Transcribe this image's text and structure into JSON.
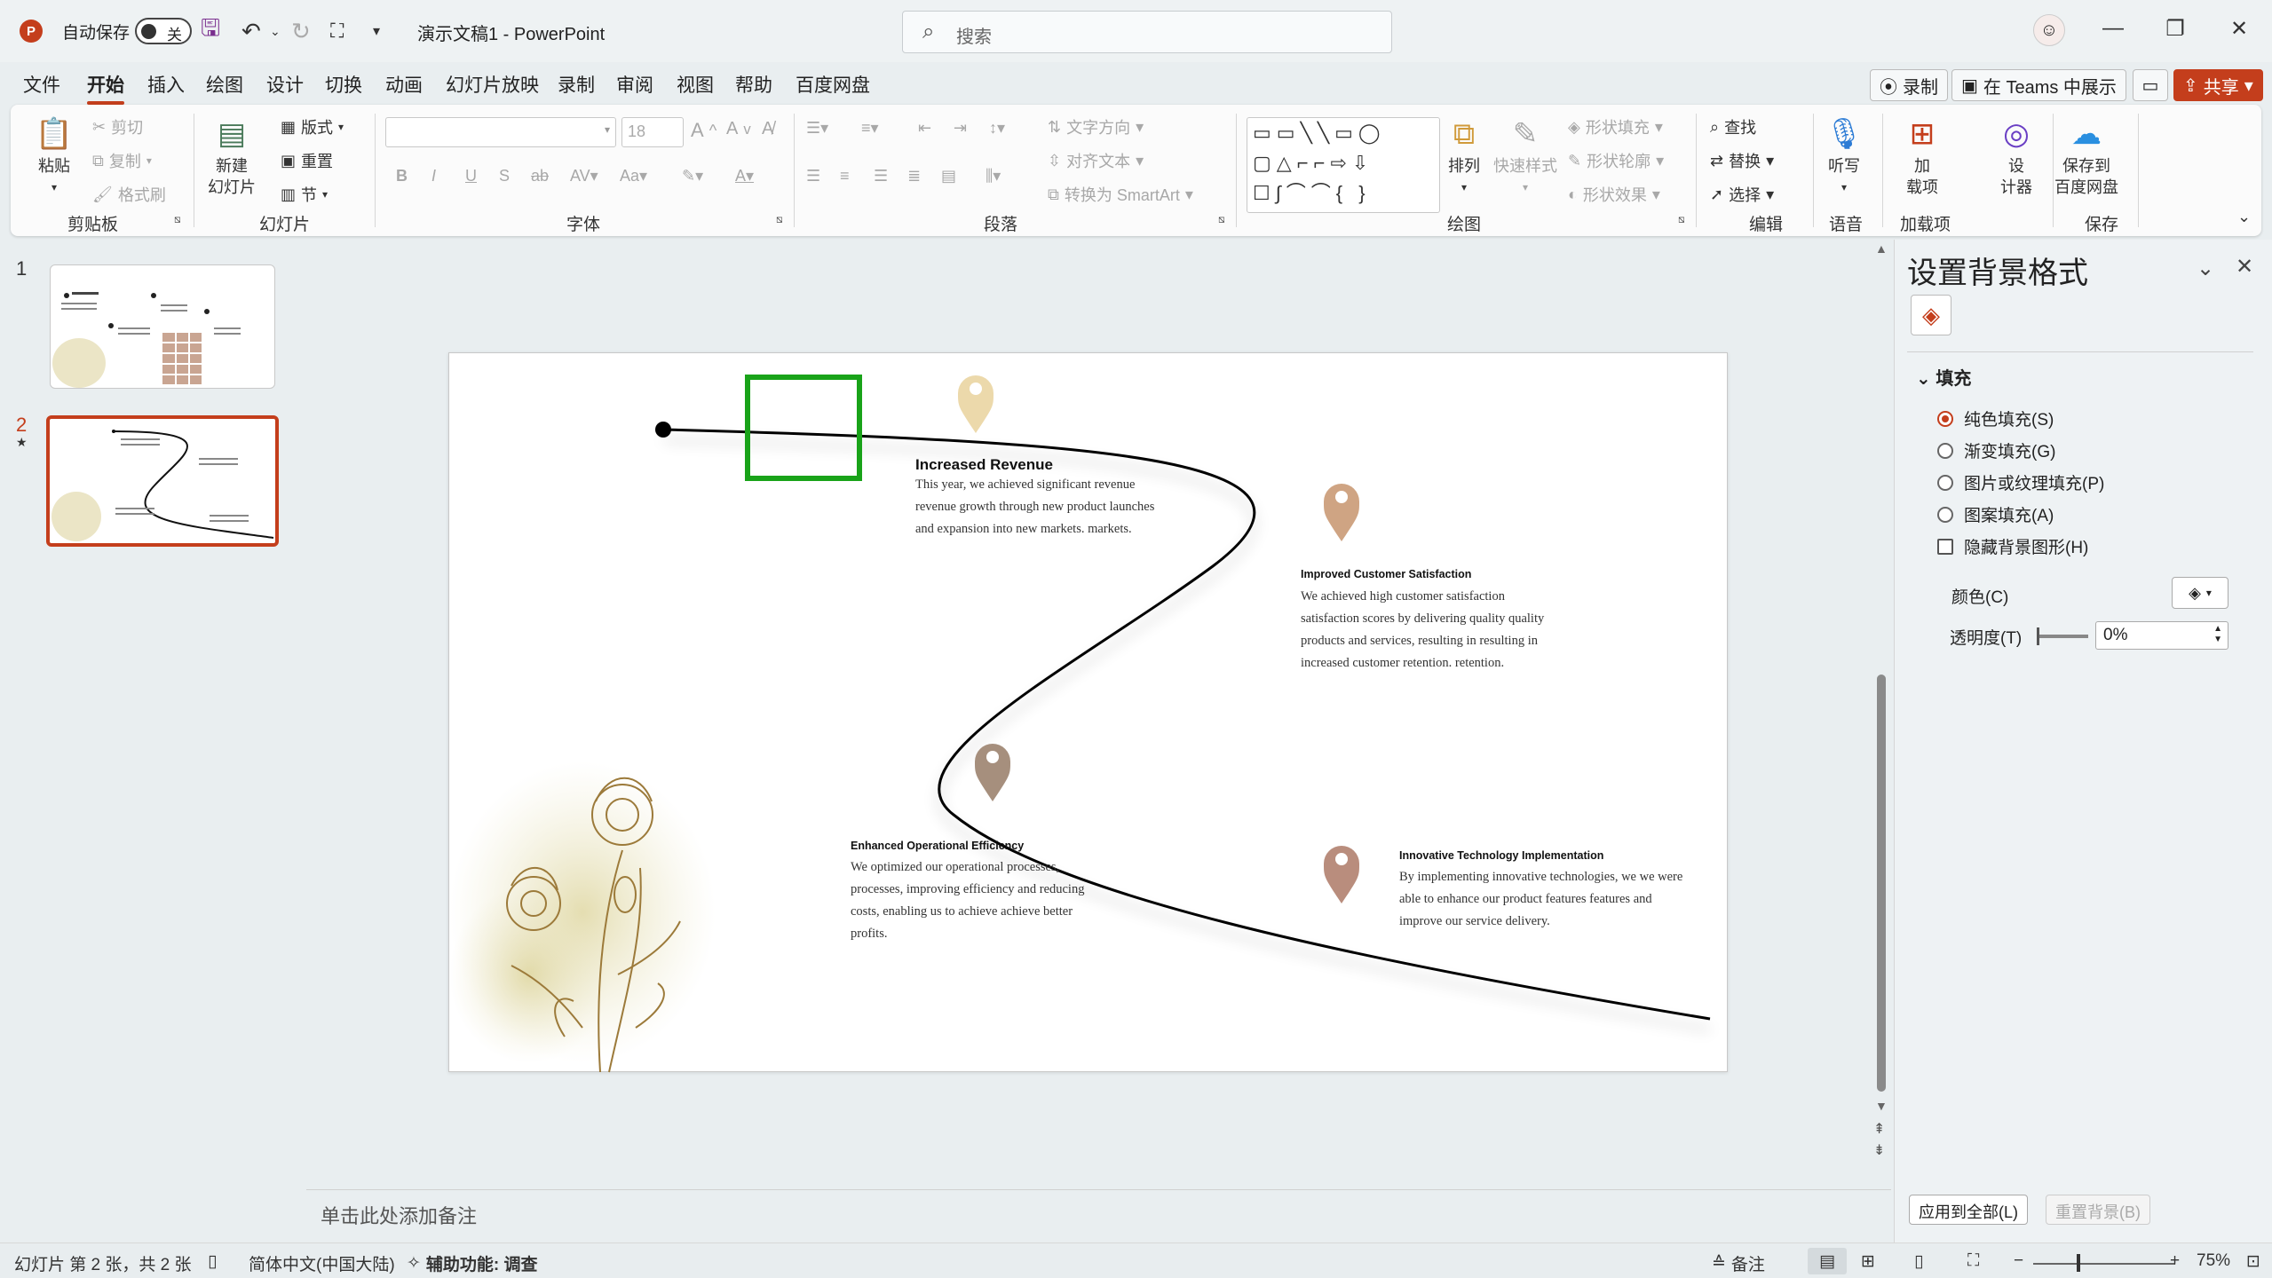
{
  "titlebar": {
    "app_logo": "P",
    "autosave_label": "自动保存",
    "autosave_state": "关",
    "doc_title": "演示文稿1  -  PowerPoint",
    "search_placeholder": "搜索"
  },
  "tabs": [
    "文件",
    "开始",
    "插入",
    "绘图",
    "设计",
    "切换",
    "动画",
    "幻灯片放映",
    "录制",
    "审阅",
    "视图",
    "帮助",
    "百度网盘"
  ],
  "top_buttons": {
    "record": "录制",
    "teams": "在 Teams 中展示",
    "share": "共享"
  },
  "ribbon": {
    "clipboard": {
      "paste": "粘贴",
      "cut": "剪切",
      "copy": "复制",
      "format_painter": "格式刷",
      "group": "剪贴板"
    },
    "slides": {
      "new_slide_1": "新建",
      "new_slide_2": "幻灯片",
      "layout": "版式",
      "reset": "重置",
      "section": "节",
      "group": "幻灯片"
    },
    "font": {
      "size": "18",
      "group": "字体"
    },
    "paragraph": {
      "text_direction": "文字方向",
      "align_text": "对齐文本",
      "smartart": "转换为 SmartArt",
      "group": "段落"
    },
    "drawing": {
      "arrange": "排列",
      "quick_styles": "快速样式",
      "shape_fill": "形状填充",
      "shape_outline": "形状轮廓",
      "shape_effects": "形状效果",
      "group": "绘图"
    },
    "editing": {
      "find": "查找",
      "replace": "替换",
      "select": "选择",
      "group": "编辑"
    },
    "voice": {
      "dictate": "听写",
      "group": "语音"
    },
    "addins": {
      "addins_1": "加",
      "addins_2": "载项",
      "group": "加载项"
    },
    "designer": {
      "label_1": "设",
      "label_2": "计器"
    },
    "save": {
      "label_1": "保存到",
      "label_2": "百度网盘",
      "group": "保存"
    }
  },
  "thumbnails": [
    {
      "number": "1"
    },
    {
      "number": "2",
      "star": "★"
    }
  ],
  "slide": {
    "items": [
      {
        "title": "Increased Revenue",
        "body": "This year, we achieved significant revenue revenue growth through new product launches and expansion into new markets. markets."
      },
      {
        "title": "Improved Customer Satisfaction",
        "body": "We achieved high customer satisfaction satisfaction scores by delivering quality quality products and services, resulting in resulting in increased customer retention. retention."
      },
      {
        "title": "Enhanced Operational Efficiency",
        "body": "We optimized our operational processes, processes, improving efficiency and reducing costs, enabling us to achieve achieve better profits."
      },
      {
        "title": "Innovative Technology Implementation",
        "body": "By implementing innovative technologies, we we were able to enhance our product features features and improve our service delivery."
      }
    ],
    "pin_colors": [
      "#ecd9ab",
      "#cfa483",
      "#a68f7d",
      "#b98d7d"
    ]
  },
  "notes_placeholder": "单击此处添加备注",
  "format_pane": {
    "title": "设置背景格式",
    "section": "填充",
    "options": [
      "纯色填充(S)",
      "渐变填充(G)",
      "图片或纹理填充(P)",
      "图案填充(A)"
    ],
    "selected_option": 0,
    "hide_bg_graphics": "隐藏背景图形(H)",
    "color_label": "颜色(C)",
    "transparency_label": "透明度(T)",
    "transparency_value": "0%",
    "apply_all": "应用到全部(L)",
    "reset_bg": "重置背景(B)"
  },
  "statusbar": {
    "slide_info": "幻灯片 第 2 张，共 2 张",
    "language": "简体中文(中国大陆)",
    "accessibility": "辅助功能: 调查",
    "notes": "备注",
    "zoom": "75%"
  }
}
